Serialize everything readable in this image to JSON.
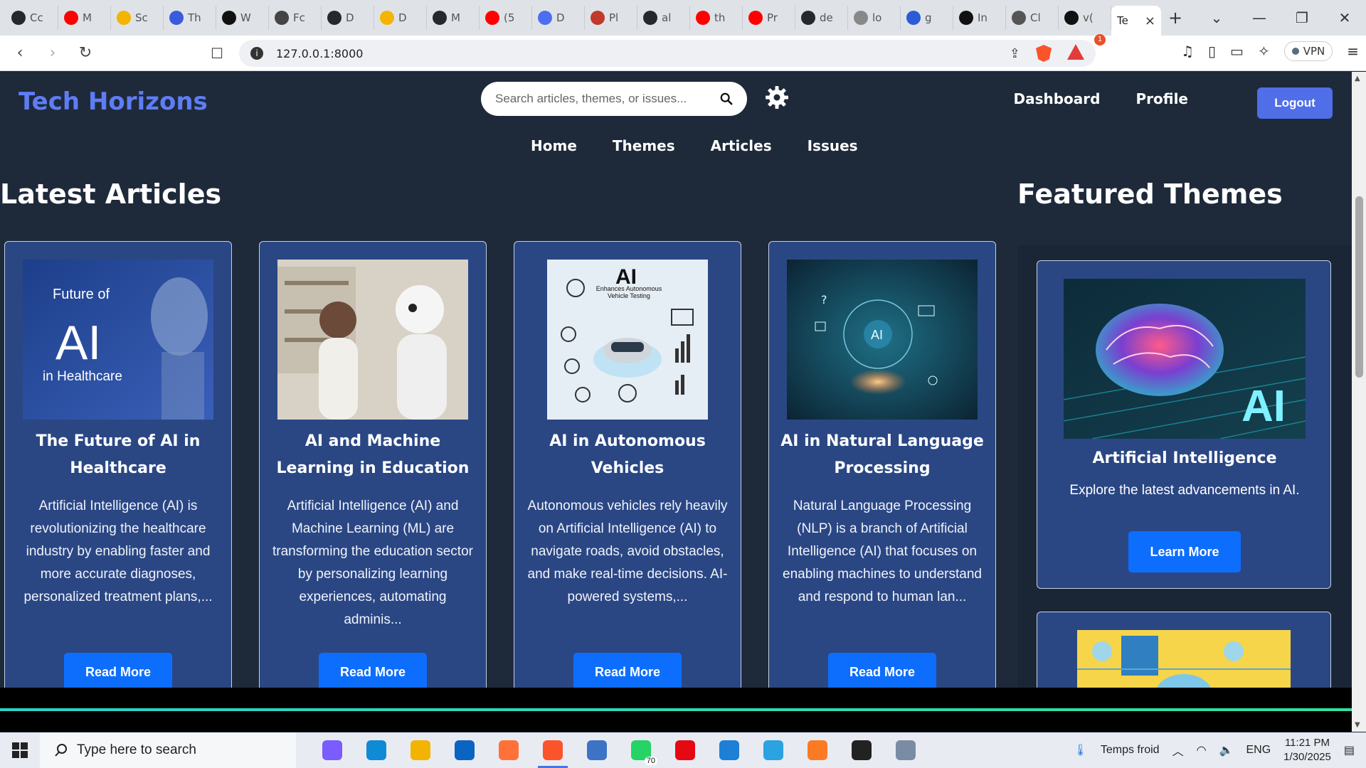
{
  "browser": {
    "tabs": [
      {
        "label": "Cc",
        "icon": "github-icon",
        "color": "#24292f"
      },
      {
        "label": "M",
        "icon": "youtube-icon",
        "color": "#ff0000"
      },
      {
        "label": "Sc",
        "icon": "scholar-icon",
        "color": "#f4b400"
      },
      {
        "label": "Th",
        "icon": "power-icon",
        "color": "#3b5bdb"
      },
      {
        "label": "W",
        "icon": "medium-icon",
        "color": "#111111"
      },
      {
        "label": "Fc",
        "icon": "openai-icon",
        "color": "#444444"
      },
      {
        "label": "D",
        "icon": "github-icon",
        "color": "#24292f"
      },
      {
        "label": "D",
        "icon": "drive-icon",
        "color": "#f4b400"
      },
      {
        "label": "M",
        "icon": "github-icon",
        "color": "#24292f"
      },
      {
        "label": "(5",
        "icon": "youtube-icon",
        "color": "#ff0000"
      },
      {
        "label": "D",
        "icon": "dart-icon",
        "color": "#4e6ef2"
      },
      {
        "label": "Pl",
        "icon": "app-icon",
        "color": "#c0392b"
      },
      {
        "label": "al",
        "icon": "github-icon",
        "color": "#24292f"
      },
      {
        "label": "th",
        "icon": "youtube-icon",
        "color": "#ff0000"
      },
      {
        "label": "Pr",
        "icon": "youtube-icon",
        "color": "#ff0000"
      },
      {
        "label": "de",
        "icon": "github-icon",
        "color": "#24292f"
      },
      {
        "label": "lo",
        "icon": "mountain-icon",
        "color": "#888888"
      },
      {
        "label": "g",
        "icon": "word-icon",
        "color": "#2b5bd7"
      },
      {
        "label": "In",
        "icon": "openai-icon",
        "color": "#111111"
      },
      {
        "label": "Cl",
        "icon": "openai-icon",
        "color": "#555555"
      },
      {
        "label": "v(",
        "icon": "vercel-icon",
        "color": "#111111"
      }
    ],
    "active_tab": "Te",
    "url": "127.0.0.1:8000",
    "rewards_badge": "1",
    "vpn_label": "VPN"
  },
  "site": {
    "brand": "Tech Horizons",
    "search_placeholder": "Search articles, themes, or issues...",
    "top_nav": [
      "Dashboard",
      "Profile"
    ],
    "logout_label": "Logout",
    "main_nav": [
      "Home",
      "Themes",
      "Articles",
      "Issues"
    ],
    "latest_heading": "Latest Articles",
    "featured_heading": "Featured Themes"
  },
  "articles": [
    {
      "title": "The Future of AI in Healthcare",
      "excerpt": "Artificial Intelligence (AI) is revolutionizing the healthcare industry by enabling faster and more accurate diagnoses, personalized treatment plans,...",
      "button": "Read More",
      "image_text": [
        "Future of",
        "AI",
        "in Healthcare"
      ]
    },
    {
      "title": "AI and Machine Learning in Education",
      "excerpt": "Artificial Intelligence (AI) and Machine Learning (ML) are transforming the education sector by personalizing learning experiences, automating adminis...",
      "button": "Read More"
    },
    {
      "title": "AI in Autonomous Vehicles",
      "excerpt": "Autonomous vehicles rely heavily on Artificial Intelligence (AI) to navigate roads, avoid obstacles, and make real-time decisions. AI-powered systems,...",
      "button": "Read More",
      "image_text": [
        "AI",
        "Enhances Autonomous Vehicle Testing"
      ]
    },
    {
      "title": "AI in Natural Language Processing",
      "excerpt": "Natural Language Processing (NLP) is a branch of Artificial Intelligence (AI) that focuses on enabling machines to understand and respond to human lan...",
      "button": "Read More",
      "image_text": [
        "AI"
      ]
    }
  ],
  "themes": [
    {
      "title": "Artificial Intelligence",
      "description": "Explore the latest advancements in AI.",
      "button": "Learn More",
      "image_text": "AI"
    }
  ],
  "taskbar": {
    "search_placeholder": "Type here to search",
    "apps": [
      {
        "name": "copilot-icon",
        "color": "#7a5cff"
      },
      {
        "name": "edge-icon",
        "color": "#0f8ad4"
      },
      {
        "name": "file-explorer-icon",
        "color": "#f2b400"
      },
      {
        "name": "outlook-icon",
        "color": "#0a64c2"
      },
      {
        "name": "firefox-icon",
        "color": "#ff7139"
      },
      {
        "name": "brave-icon",
        "color": "#fb542b"
      },
      {
        "name": "qbittorrent-icon",
        "color": "#3d73c4"
      },
      {
        "name": "whatsapp-icon",
        "color": "#25d366"
      },
      {
        "name": "netflix-icon",
        "color": "#e50914"
      },
      {
        "name": "vscode-icon",
        "color": "#1e7fd6"
      },
      {
        "name": "telegram-icon",
        "color": "#2aa3e0"
      },
      {
        "name": "xampp-icon",
        "color": "#fb7a24"
      },
      {
        "name": "terminal-icon",
        "color": "#222222"
      },
      {
        "name": "photos-icon",
        "color": "#7a8ca3"
      }
    ],
    "whatsapp_badge": "70",
    "weather": "Temps froid",
    "language": "ENG",
    "time": "11:21 PM",
    "date": "1/30/2025"
  }
}
